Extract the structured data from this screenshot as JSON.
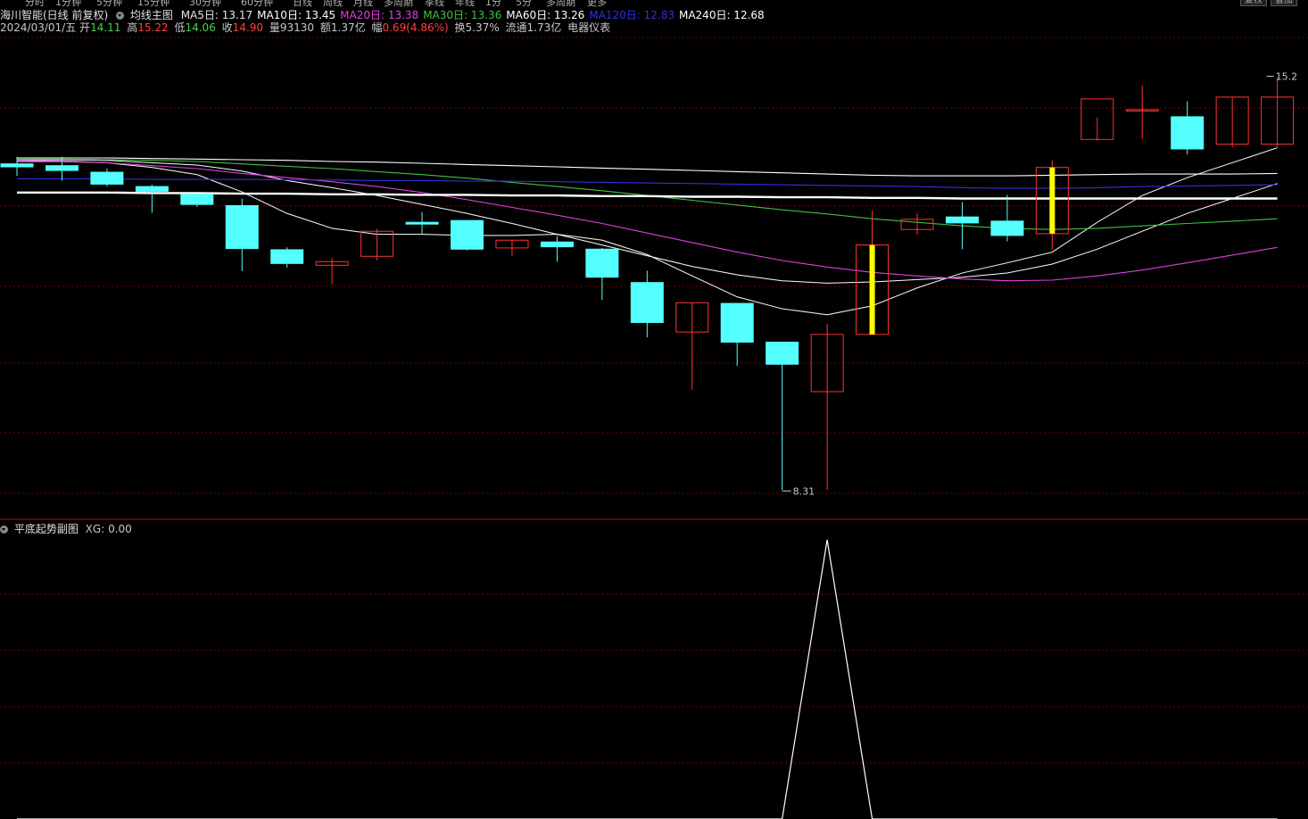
{
  "top_menu": {
    "items": [
      "分时",
      "1分钟",
      "5分钟",
      "15分钟",
      "30分钟",
      "60分钟",
      "日线",
      "周线",
      "月线",
      "多周期",
      "季线",
      "年线",
      "1分",
      "5分",
      "多周期",
      "更多"
    ],
    "buttons": [
      "复权",
      "叠加"
    ]
  },
  "header": {
    "stock": "海川智能(日线 前复权)",
    "indicator": "均线主图",
    "ma": [
      {
        "label": "MA5日:",
        "value": "13.17",
        "color": "#e6e6e6"
      },
      {
        "label": "MA10日:",
        "value": "13.45",
        "color": "#ffffff"
      },
      {
        "label": "MA20日:",
        "value": "13.38",
        "color": "#e040e0"
      },
      {
        "label": "MA30日:",
        "value": "13.36",
        "color": "#40c040"
      },
      {
        "label": "MA60日:",
        "value": "13.26",
        "color": "#ffffff"
      },
      {
        "label": "MA120日:",
        "value": "12.83",
        "color": "#3030e0"
      },
      {
        "label": "MA240日:",
        "value": "12.68",
        "color": "#ffffff"
      }
    ]
  },
  "ohlc": {
    "date": "2024/03/01/五",
    "open_label": "开",
    "open": "14.11",
    "high_label": "高",
    "high": "15.22",
    "low_label": "低",
    "low": "14.06",
    "close_label": "收",
    "close": "14.90",
    "vol_label": "量",
    "vol": "93130",
    "amount_label": "额",
    "amount": "1.37亿",
    "change_label": "幅",
    "change": "0.69(4.86%)",
    "turnover_label": "换",
    "turnover": "5.37%",
    "float_label": "流通",
    "float": "1.73亿",
    "sector": "电器仪表"
  },
  "subchart": {
    "title": "平底起势副图",
    "xg_label": "XG:",
    "xg_value": "0.00"
  },
  "colors": {
    "up": "#ff3232",
    "down": "#54ffff",
    "grid": "#7a0000",
    "signal": "#ffff00"
  },
  "chart_data": {
    "type": "candlestick",
    "ylim": [
      8.0,
      15.9
    ],
    "high_mark": "15.2",
    "low_mark": "8.31",
    "candles": [
      {
        "o": 13.78,
        "h": 13.9,
        "l": 13.58,
        "c": 13.73
      },
      {
        "o": 13.75,
        "h": 13.9,
        "l": 13.5,
        "c": 13.67
      },
      {
        "o": 13.64,
        "h": 13.7,
        "l": 13.4,
        "c": 13.44
      },
      {
        "o": 13.4,
        "h": 13.43,
        "l": 12.96,
        "c": 13.32
      },
      {
        "o": 13.27,
        "h": 13.27,
        "l": 13.06,
        "c": 13.1
      },
      {
        "o": 13.08,
        "h": 13.2,
        "l": 11.98,
        "c": 12.36
      },
      {
        "o": 12.34,
        "h": 12.38,
        "l": 12.04,
        "c": 12.11
      },
      {
        "o": 12.08,
        "h": 12.2,
        "l": 11.76,
        "c": 12.14
      },
      {
        "o": 12.23,
        "h": 12.69,
        "l": 12.16,
        "c": 12.65
      },
      {
        "o": 12.8,
        "h": 12.97,
        "l": 12.61,
        "c": 12.77
      },
      {
        "o": 12.83,
        "h": 12.83,
        "l": 12.33,
        "c": 12.35
      },
      {
        "o": 12.37,
        "h": 12.51,
        "l": 12.23,
        "c": 12.5
      },
      {
        "o": 12.47,
        "h": 12.57,
        "l": 12.14,
        "c": 12.39
      },
      {
        "o": 12.35,
        "h": 12.37,
        "l": 11.5,
        "c": 11.88
      },
      {
        "o": 11.79,
        "h": 11.99,
        "l": 10.87,
        "c": 11.12
      },
      {
        "o": 10.96,
        "h": 11.45,
        "l": 9.99,
        "c": 11.45
      },
      {
        "o": 11.44,
        "h": 11.44,
        "l": 10.39,
        "c": 10.79
      },
      {
        "o": 10.79,
        "h": 10.79,
        "l": 8.31,
        "c": 10.42
      },
      {
        "o": 9.96,
        "h": 11.1,
        "l": 8.31,
        "c": 10.92
      },
      {
        "o": 10.92,
        "h": 13.0,
        "l": 10.92,
        "c": 12.42
      },
      {
        "o": 12.68,
        "h": 12.95,
        "l": 12.59,
        "c": 12.85
      },
      {
        "o": 12.89,
        "h": 13.14,
        "l": 12.35,
        "c": 12.79
      },
      {
        "o": 12.82,
        "h": 13.26,
        "l": 12.48,
        "c": 12.58
      },
      {
        "o": 12.61,
        "h": 13.84,
        "l": 12.34,
        "c": 13.72
      },
      {
        "o": 14.19,
        "h": 14.56,
        "l": 14.17,
        "c": 14.87
      },
      {
        "o": 14.69,
        "h": 15.09,
        "l": 14.2,
        "c": 14.69
      },
      {
        "o": 14.57,
        "h": 14.83,
        "l": 13.94,
        "c": 14.03
      },
      {
        "o": 14.11,
        "h": 14.9,
        "l": 14.06,
        "c": 14.9
      },
      {
        "o": 14.11,
        "h": 15.22,
        "l": 14.06,
        "c": 14.9
      }
    ],
    "signal_bars": [
      19,
      23
    ],
    "ma_lines": [
      {
        "name": "MA5",
        "color": "#e6e6e6",
        "width": 1.1,
        "values": [
          13.82,
          13.82,
          13.8,
          13.72,
          13.6,
          13.31,
          12.95,
          12.7,
          12.6,
          12.6,
          12.58,
          12.58,
          12.6,
          12.5,
          12.26,
          11.9,
          11.55,
          11.35,
          11.25,
          11.4,
          11.7,
          11.95,
          12.12,
          12.3,
          12.8,
          13.25,
          13.55,
          13.8,
          14.05
        ]
      },
      {
        "name": "MA10",
        "color": "#ffffff",
        "width": 1.0,
        "values": [
          13.85,
          13.85,
          13.84,
          13.8,
          13.76,
          13.66,
          13.5,
          13.38,
          13.25,
          13.1,
          12.95,
          12.78,
          12.6,
          12.42,
          12.24,
          12.06,
          11.92,
          11.82,
          11.78,
          11.8,
          11.84,
          11.88,
          11.95,
          12.1,
          12.35,
          12.65,
          12.95,
          13.2,
          13.45
        ]
      },
      {
        "name": "MA20",
        "color": "#e040e0",
        "width": 1.1,
        "values": [
          13.84,
          13.83,
          13.8,
          13.75,
          13.7,
          13.62,
          13.55,
          13.48,
          13.4,
          13.3,
          13.18,
          13.05,
          12.92,
          12.78,
          12.62,
          12.46,
          12.3,
          12.16,
          12.05,
          11.96,
          11.9,
          11.85,
          11.82,
          11.83,
          11.9,
          12.0,
          12.12,
          12.25,
          12.38
        ]
      },
      {
        "name": "MA30",
        "color": "#40c040",
        "width": 1.1,
        "values": [
          13.86,
          13.86,
          13.85,
          13.84,
          13.82,
          13.78,
          13.74,
          13.7,
          13.65,
          13.6,
          13.54,
          13.47,
          13.4,
          13.33,
          13.25,
          13.17,
          13.09,
          13.01,
          12.94,
          12.86,
          12.8,
          12.74,
          12.7,
          12.68,
          12.7,
          12.74,
          12.78,
          12.82,
          12.86
        ]
      },
      {
        "name": "MA60",
        "color": "#ffffff",
        "width": 1.1,
        "values": [
          13.88,
          13.88,
          13.88,
          13.87,
          13.86,
          13.85,
          13.84,
          13.82,
          13.81,
          13.79,
          13.77,
          13.75,
          13.73,
          13.71,
          13.69,
          13.67,
          13.65,
          13.63,
          13.61,
          13.59,
          13.58,
          13.58,
          13.58,
          13.59,
          13.6,
          13.61,
          13.61,
          13.61,
          13.62
        ]
      },
      {
        "name": "MA120",
        "color": "#3030e0",
        "width": 1.1,
        "values": [
          13.53,
          13.53,
          13.53,
          13.52,
          13.52,
          13.52,
          13.51,
          13.51,
          13.5,
          13.5,
          13.49,
          13.49,
          13.48,
          13.47,
          13.46,
          13.45,
          13.44,
          13.43,
          13.42,
          13.41,
          13.4,
          13.38,
          13.37,
          13.37,
          13.38,
          13.4,
          13.41,
          13.42,
          13.43
        ]
      },
      {
        "name": "MA240",
        "color": "#ffffff",
        "width": 2.4,
        "values": [
          13.3,
          13.3,
          13.3,
          13.29,
          13.29,
          13.28,
          13.28,
          13.27,
          13.27,
          13.26,
          13.26,
          13.25,
          13.25,
          13.24,
          13.24,
          13.23,
          13.23,
          13.22,
          13.22,
          13.21,
          13.21,
          13.2,
          13.2,
          13.2,
          13.2,
          13.2,
          13.2,
          13.2,
          13.2
        ]
      }
    ],
    "sub_series": {
      "name": "XG",
      "color": "#ffffff",
      "ylim": [
        0,
        1
      ],
      "values": [
        0,
        0,
        0,
        0,
        0,
        0,
        0,
        0,
        0,
        0,
        0,
        0,
        0,
        0,
        0,
        0,
        0,
        0,
        1,
        0,
        0,
        0,
        0,
        0,
        0,
        0,
        0,
        0,
        0
      ]
    }
  }
}
